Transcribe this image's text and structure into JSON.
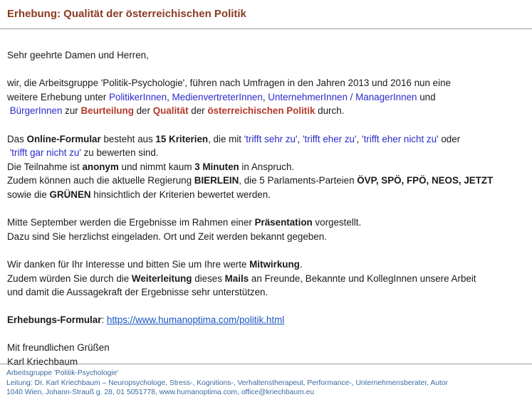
{
  "header": {
    "title": "Erhebung: Qualität der österreichischen Politik"
  },
  "body": {
    "greeting": "Sehr geehrte Damen und Herren,",
    "p1": {
      "a": "wir, die Arbeitsgruppe 'Politik-Psychologie', führen nach Umfragen in den Jahren 2013 und 2016 nun eine",
      "b": "weitere Erhebung unter ",
      "g1": "PolitikerInnen",
      "c1": ", ",
      "g2": "MedienvertreterInnen",
      "c2": ", ",
      "g3": "UnternehmerInnen / ManagerInnen",
      "c3": " und",
      "g4": "BürgerInnen",
      "d1": " zur ",
      "e1": "Beurteilung",
      "d2": " der ",
      "e2": "Qualität",
      "d3": " der ",
      "e3": "österreichischen Politik",
      "d4": " durch."
    },
    "p2": {
      "a": "Das ",
      "form": "Online-Formular",
      "b": " besteht aus ",
      "count": "15 Kriterien",
      "c": ", die mit ",
      "o1": "'trifft sehr zu'",
      "s1": ",  ",
      "o2": "'trifft eher zu'",
      "s2": ", ",
      "o3": "'trifft eher nicht zu'",
      "s3": " oder",
      "o4": "'trifft gar nicht zu'",
      "d": " zu bewerten sind.",
      "e": "Die Teilnahme ist ",
      "anon": "anonym",
      "f": " und nimmt kaum ",
      "min": "3 Minuten",
      "g": " in Anspruch.",
      "h": "Zudem können auch die aktuelle Regierung ",
      "gov": "BIERLEIN",
      "i": ", die 5 Parlaments-Parteien ",
      "parties": "ÖVP, SPÖ, FPÖ, NEOS, JETZT",
      "j": "sowie die ",
      "green": "GRÜNEN",
      "k": " hinsichtlich der Kriterien bewertet werden."
    },
    "p3": {
      "a": "Mitte September werden die Ergebnisse im Rahmen einer ",
      "pres": "Präsentation",
      "b": " vorgestellt.",
      "c": "Dazu sind Sie herzlichst eingeladen. Ort und Zeit werden bekannt gegeben."
    },
    "p4": {
      "a": "Wir danken für Ihr Interesse und bitten Sie um Ihre werte ",
      "mit": "Mitwirkung",
      "b": ".",
      "c": "Zudem würden Sie durch die ",
      "fw": "Weiterleitung",
      "d": " dieses ",
      "mails": "Mails",
      "e": " an Freunde, Bekannte und KollegInnen unsere Arbeit",
      "f": "und damit die Aussagekraft der Ergebnisse sehr unterstützen."
    },
    "formline": {
      "label": "Erhebungs-Formular",
      "colon": ": ",
      "url": "https://www.humanoptima.com/politik.html"
    },
    "closing": "Mit freundlichen Grüßen",
    "signature": "Karl Kriechbaum"
  },
  "footer": {
    "line1": "Arbeitsgruppe 'Politik-Psychologie'",
    "line2": "Leitung:  Dr. Karl Kriechbaum – Neuropsychologe, Stress-, Kognitions-, Verhaltenstherapeut, Performance-, Unternehmensberater, Autor",
    "line3": "1040 Wien, Johann-Strauß g. 28, 01 5051778, www.humanoptima.com, office@kriechbaum.eu"
  }
}
